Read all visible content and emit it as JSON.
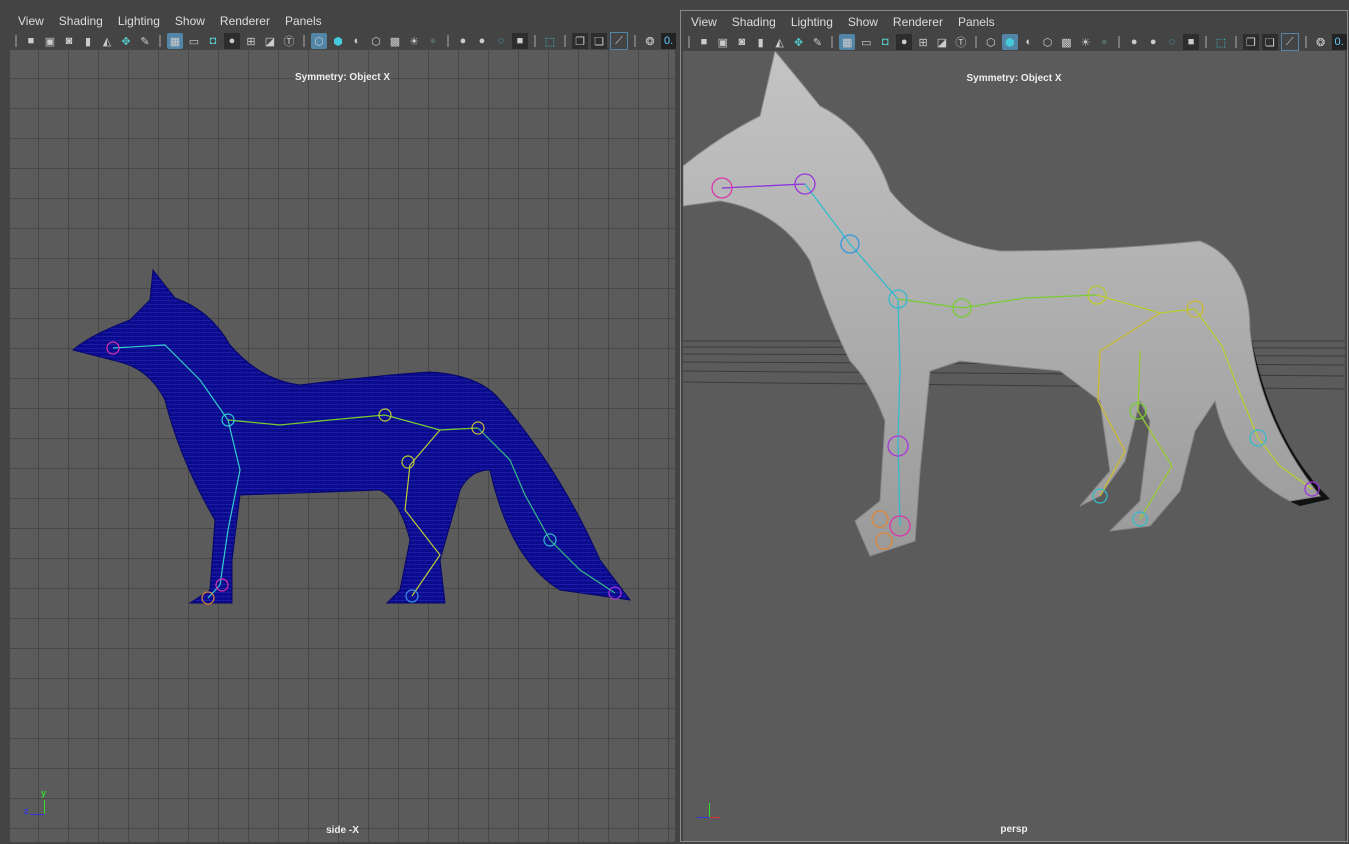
{
  "menus": [
    "View",
    "Shading",
    "Lighting",
    "Show",
    "Renderer",
    "Panels"
  ],
  "toolbar_icons": [
    "camera-icon",
    "camera-lock-icon",
    "camera-attributes-icon",
    "bookmark-icon",
    "image-plane-icon",
    "2d-pan-zoom-icon",
    "grease-pencil-icon",
    "grid-icon",
    "film-gate-icon",
    "resolution-gate-icon",
    "gate-mask-icon",
    "field-chart-icon",
    "safe-action-icon",
    "safe-title-icon",
    "wireframe-icon",
    "smooth-shade-icon",
    "default-material-icon",
    "wireframe-on-shaded-icon",
    "textured-icon",
    "lights-icon",
    "shadows-icon",
    "screen-space-ao-icon",
    "motion-blur-icon",
    "anti-aliasing-icon",
    "depth-of-field-icon",
    "isolate-select-icon",
    "xray-icon",
    "xray-active-components-icon",
    "xray-joints-icon",
    "exposure-icon"
  ],
  "readout": "0.",
  "left_view": {
    "symmetry": "Symmetry: Object X",
    "camera": "side -X",
    "axis": {
      "y": "y",
      "z": "z"
    }
  },
  "right_view": {
    "symmetry": "Symmetry: Object X",
    "camera": "persp"
  },
  "colors": {
    "wireframe": "#0a0a8c",
    "shaded": "#ababab",
    "active_border": "#8a8a8a",
    "highlight": "#5285a6"
  }
}
